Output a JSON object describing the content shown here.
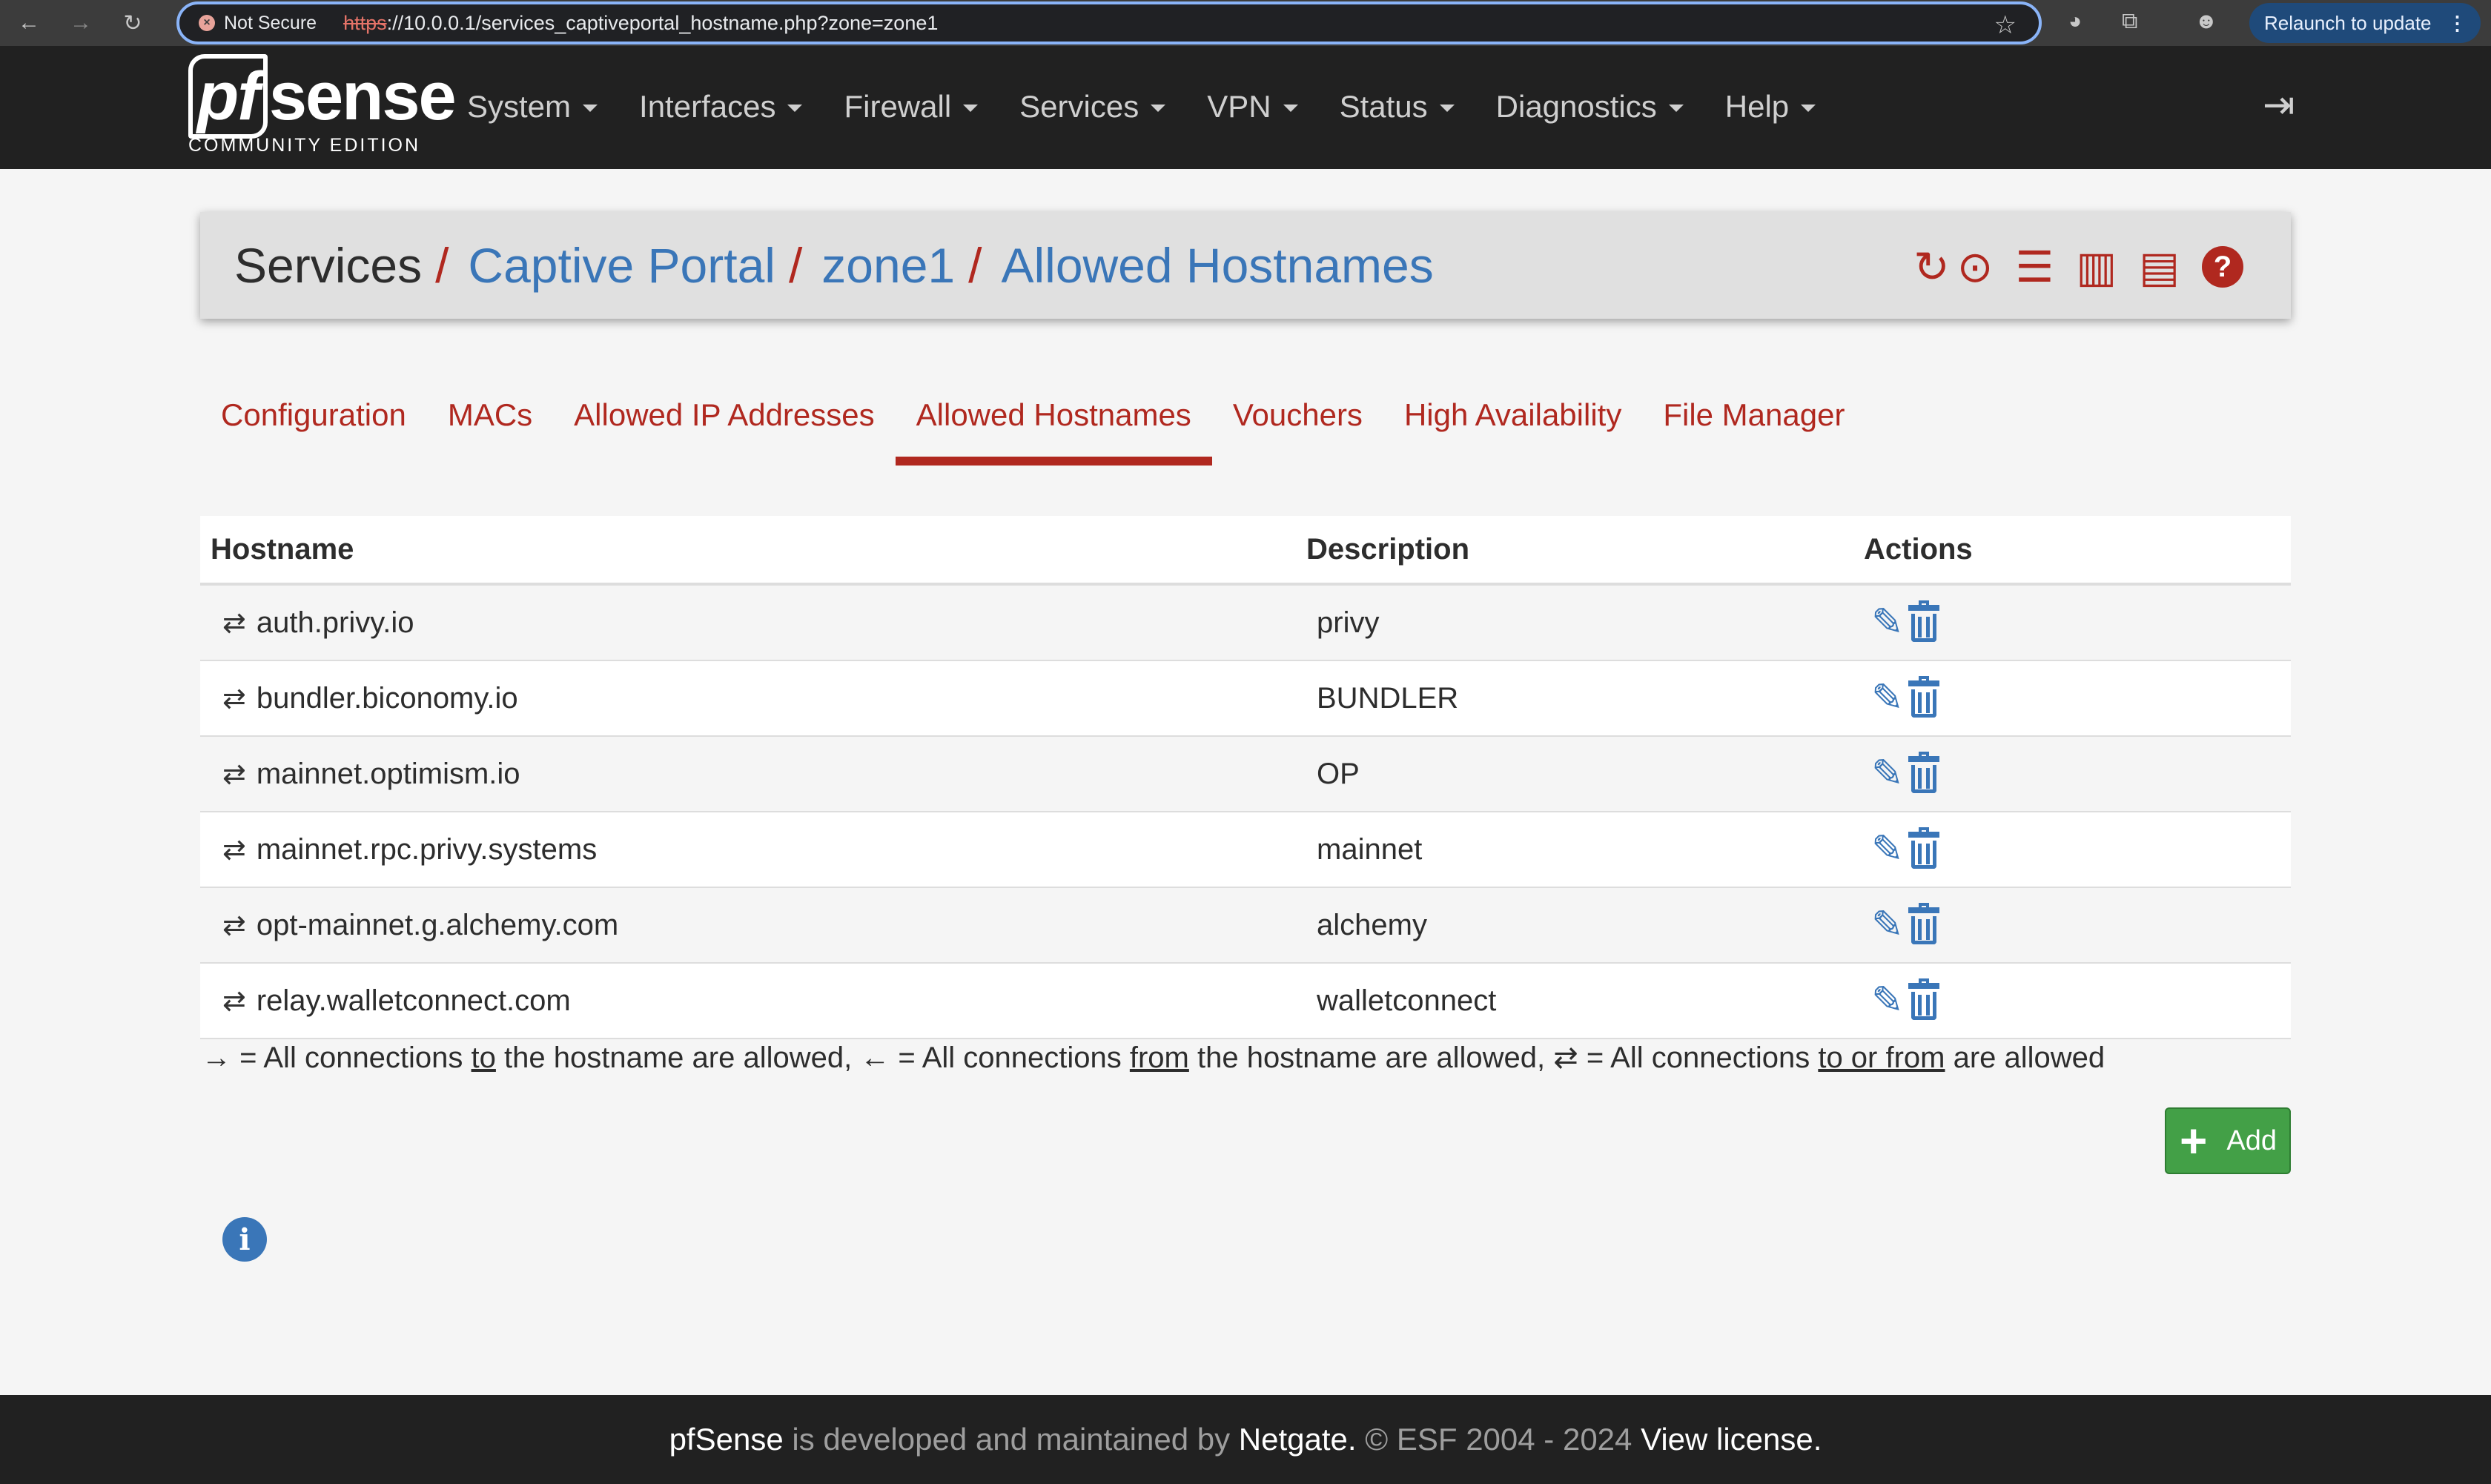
{
  "browser": {
    "security_label": "Not Secure",
    "url_scheme": "https",
    "url_rest": "://10.0.0.1/services_captiveportal_hostname.php?zone=zone1",
    "relaunch_label": "Relaunch to update"
  },
  "navbar": {
    "logo_pf": "pf",
    "logo_sense": "sense",
    "logo_sub": "COMMUNITY EDITION",
    "menu": [
      "System",
      "Interfaces",
      "Firewall",
      "Services",
      "VPN",
      "Status",
      "Diagnostics",
      "Help"
    ]
  },
  "breadcrumb": {
    "items": [
      "Services",
      "Captive Portal",
      "zone1",
      "Allowed Hostnames"
    ],
    "separator": "/"
  },
  "tabs": [
    "Configuration",
    "MACs",
    "Allowed IP Addresses",
    "Allowed Hostnames",
    "Vouchers",
    "High Availability",
    "File Manager"
  ],
  "active_tab": "Allowed Hostnames",
  "table": {
    "headers": {
      "hostname": "Hostname",
      "description": "Description",
      "actions": "Actions"
    },
    "rows": [
      {
        "direction": "⇄",
        "hostname": "auth.privy.io",
        "description": "privy"
      },
      {
        "direction": "⇄",
        "hostname": "bundler.biconomy.io",
        "description": "BUNDLER"
      },
      {
        "direction": "⇄",
        "hostname": "mainnet.optimism.io",
        "description": "OP"
      },
      {
        "direction": "⇄",
        "hostname": "mainnet.rpc.privy.systems",
        "description": "mainnet"
      },
      {
        "direction": "⇄",
        "hostname": "opt-mainnet.g.alchemy.com",
        "description": "alchemy"
      },
      {
        "direction": "⇄",
        "hostname": "relay.walletconnect.com",
        "description": "walletconnect"
      }
    ]
  },
  "legend": {
    "to_arrow": "→",
    "to_text_a": " = All connections ",
    "to_word": "to",
    "to_text_b": " the hostname are allowed, ",
    "from_arrow": "←",
    "from_text_a": " = All connections ",
    "from_word": "from",
    "from_text_b": " the hostname are allowed, ",
    "both_arrow": "⇄",
    "both_text_a": " = All connections ",
    "both_word": "to or from",
    "both_text_b": " are allowed"
  },
  "add_button_label": "Add",
  "footer": {
    "brand": "pfSense",
    "text1": " is developed and maintained by ",
    "company": "Netgate.",
    "text2": " © ESF 2004 - 2024 ",
    "license": "View license."
  },
  "colors": {
    "accent_red": "#b0281f",
    "link_blue": "#3a76b8",
    "add_green": "#43a047",
    "navbar_bg": "#212121"
  }
}
